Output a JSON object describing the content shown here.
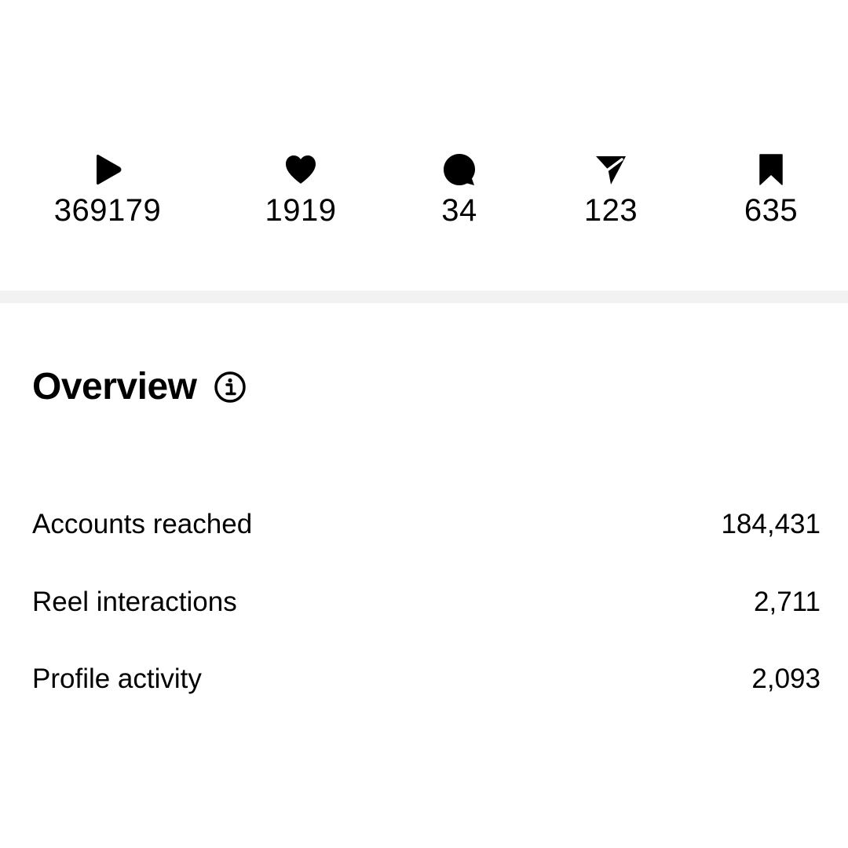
{
  "stats": [
    {
      "icon": "play-icon",
      "value": "369179"
    },
    {
      "icon": "heart-icon",
      "value": "1919"
    },
    {
      "icon": "comment-icon",
      "value": "34"
    },
    {
      "icon": "send-icon",
      "value": "123"
    },
    {
      "icon": "bookmark-icon",
      "value": "635"
    }
  ],
  "overview": {
    "title": "Overview",
    "info_icon": "info-icon",
    "metrics": [
      {
        "label": "Accounts reached",
        "value": "184,431"
      },
      {
        "label": "Reel interactions",
        "value": "2,711"
      },
      {
        "label": "Profile activity",
        "value": "2,093"
      }
    ]
  },
  "colors": {
    "text": "#000000",
    "background": "#ffffff",
    "divider": "#f2f2f2"
  }
}
